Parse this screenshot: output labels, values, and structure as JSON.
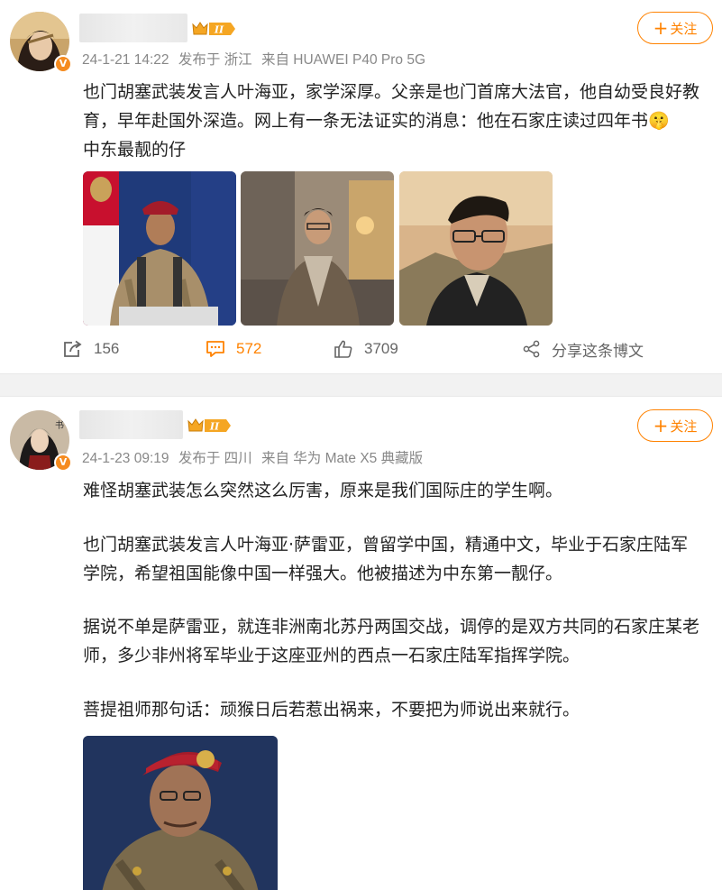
{
  "post1": {
    "level_label": "II",
    "verified_mark": "V",
    "timestamp": "24-1-21 14:22",
    "location": "发布于 浙江",
    "device": "来自 HUAWEI P40 Pro 5G",
    "follow_label": "关注",
    "text_line1": "也门胡塞武装发言人叶海亚，家学深厚。父亲是也门首席大法官，他自幼受良好教",
    "text_line2": "育，早年赴国外深造。网上有一条无法证实的消息：他在石家庄读过四年书🤫",
    "text_line3": "中东最靓的仔",
    "images": [
      "photo-1",
      "photo-2",
      "photo-3"
    ],
    "repost_count": "156",
    "comment_count": "572",
    "like_count": "3709",
    "share_label": "分享这条博文"
  },
  "post2": {
    "level_label": "II",
    "verified_mark": "V",
    "timestamp": "24-1-23 09:19",
    "location": "发布于 四川",
    "device": "来自 华为 Mate X5 典藏版",
    "follow_label": "关注",
    "p1": "难怪胡塞武装怎么突然这么厉害，原来是我们国际庄的学生啊。",
    "p2_line1": "也门胡塞武装发言人叶海亚·萨雷亚，曾留学中国，精通中文，毕业于石家庄陆军",
    "p2_line2": "学院，希望祖国能像中国一样强大。他被描述为中东第一靓仔。",
    "p3_line1": "据说不单是萨雷亚，就连非洲南北苏丹两国交战，调停的是双方共同的石家庄某老",
    "p3_line2": "师，多少非州将军毕业于这座亚州的西点一石家庄陆军指挥学院。",
    "p4": "菩提祖师那句话：顽猴日后若惹出祸来，不要把为师说出来就行。"
  },
  "colors": {
    "accent": "#ff8200",
    "meta_text": "#888888",
    "verified_badge": "#f58b1f",
    "divider": "#f2f2f2"
  },
  "icons": {
    "repost": "repost-icon",
    "comment": "comment-icon",
    "like": "like-icon",
    "share": "share-icon",
    "crown": "crown-icon"
  }
}
